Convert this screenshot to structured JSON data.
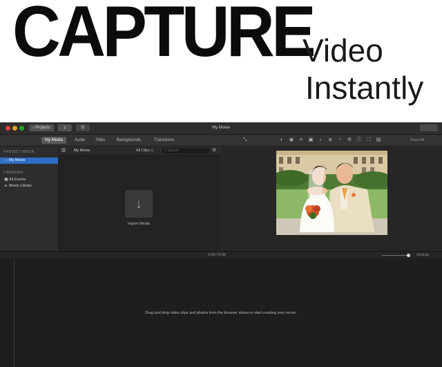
{
  "banner": {
    "title": "CAPTURE",
    "line1": "Video",
    "line2": "Instantly"
  },
  "window": {
    "title": "My Movie",
    "back_button_label": "Projects"
  },
  "toolbar": {
    "tabs": [
      {
        "label": "My Media",
        "active": true
      },
      {
        "label": "Audio",
        "active": false
      },
      {
        "label": "Titles",
        "active": false
      },
      {
        "label": "Backgrounds",
        "active": false
      },
      {
        "label": "Transitions",
        "active": false
      }
    ],
    "right_label": "Reset All"
  },
  "sidebar": {
    "project_media_header": "PROJECT MEDIA",
    "project_item": "My Movie",
    "libraries_header": "LIBRARIES",
    "all_events": "All Events",
    "movie_library": "Movie Library"
  },
  "browser": {
    "title": "My Movie",
    "filter": "All Clips ◇",
    "search_placeholder": "Search",
    "import_label": "Import Media"
  },
  "timeline": {
    "timecode": "0:00  /  0:00",
    "settings_label": "Settings",
    "message": "Drag and drop video clips and photos from the browser above to start creating your movie."
  },
  "colors": {
    "selection_blue": "#2e6ec5",
    "app_background": "#2b2b2b",
    "timeline_background": "#1e1e1e"
  }
}
